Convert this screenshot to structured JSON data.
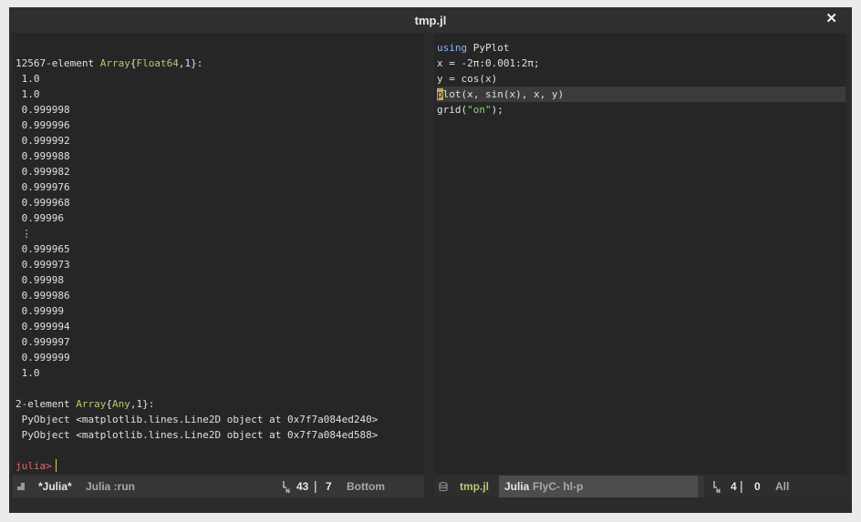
{
  "window": {
    "title": "tmp.jl",
    "close_glyph": "✕"
  },
  "repl": {
    "lines": [
      "",
      [
        {
          "t": "12567-element "
        },
        {
          "t": "Array",
          "c": "type"
        },
        {
          "t": "{"
        },
        {
          "t": "Float64",
          "c": "type"
        },
        {
          "t": ",1}:"
        }
      ],
      " 1.0",
      " 1.0",
      " 0.999998",
      " 0.999996",
      " 0.999992",
      " 0.999988",
      " 0.999982",
      " 0.999976",
      " 0.999968",
      " 0.99996",
      " ⋮",
      " 0.999965",
      " 0.999973",
      " 0.99998",
      " 0.999986",
      " 0.99999",
      " 0.999994",
      " 0.999997",
      " 0.999999",
      " 1.0",
      "",
      [
        {
          "t": "2-element "
        },
        {
          "t": "Array",
          "c": "type"
        },
        {
          "t": "{"
        },
        {
          "t": "Any",
          "c": "type"
        },
        {
          "t": ",1}:"
        }
      ],
      " PyObject <matplotlib.lines.Line2D object at 0x7f7a084ed240>",
      " PyObject <matplotlib.lines.Line2D object at 0x7f7a084ed588>",
      ""
    ],
    "prompt": "julia>"
  },
  "editor": {
    "lines": [
      [
        {
          "t": "using",
          "c": "kw"
        },
        {
          "t": " PyPlot"
        }
      ],
      "x = -2π:0.001:2π;",
      "y = cos(x)",
      [
        {
          "t": "p",
          "c": "blockcur"
        },
        {
          "t": "lot(x, sin(x), x, y)"
        }
      ],
      [
        {
          "t": "grid("
        },
        {
          "t": "\"on\"",
          "c": "str"
        },
        {
          "t": ");"
        }
      ]
    ],
    "current_line": 3
  },
  "modeline_left": {
    "buffer": "*Julia*",
    "mode": "Julia :run",
    "line": "43",
    "col": "7",
    "position": "Bottom"
  },
  "modeline_right": {
    "buffer": "tmp.jl",
    "mode": "Julia",
    "minor": "FlyC- hl-p",
    "line": "4",
    "col": "0",
    "position": "All"
  }
}
